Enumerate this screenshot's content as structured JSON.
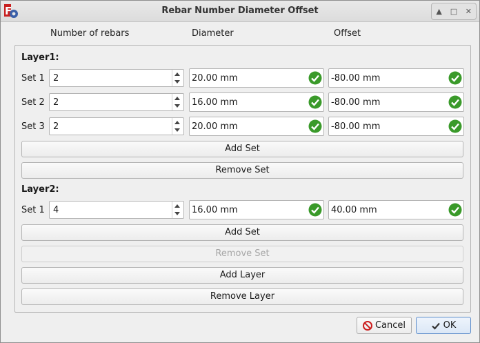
{
  "window": {
    "title": "Rebar Number Diameter Offset",
    "app_icon": "freecad-gear-icon",
    "controls": [
      "up-arrow-icon",
      "restore-icon",
      "close-icon"
    ]
  },
  "columns": {
    "number": "Number of rebars",
    "diameter": "Diameter",
    "offset": "Offset"
  },
  "layers": [
    {
      "title": "Layer1:",
      "sets": [
        {
          "label": "Set 1",
          "number": "2",
          "diameter": "20.00 mm",
          "offset": "-80.00 mm"
        },
        {
          "label": "Set 2",
          "number": "2",
          "diameter": "16.00 mm",
          "offset": "-80.00 mm"
        },
        {
          "label": "Set 3",
          "number": "2",
          "diameter": "20.00 mm",
          "offset": "-80.00 mm"
        }
      ],
      "add_set": "Add Set",
      "remove_set": "Remove Set",
      "remove_set_enabled": true
    },
    {
      "title": "Layer2:",
      "sets": [
        {
          "label": "Set 1",
          "number": "4",
          "diameter": "16.00 mm",
          "offset": "40.00 mm"
        }
      ],
      "add_set": "Add Set",
      "remove_set": "Remove Set",
      "remove_set_enabled": false
    }
  ],
  "add_layer": "Add Layer",
  "remove_layer": "Remove Layer",
  "dialog": {
    "cancel": "Cancel",
    "ok": "OK",
    "cancel_icon": "no-entry-icon",
    "ok_icon": "checkmark-icon"
  },
  "colors": {
    "valid_check": "#3a9a2a",
    "accent": "#5b8bc9"
  }
}
